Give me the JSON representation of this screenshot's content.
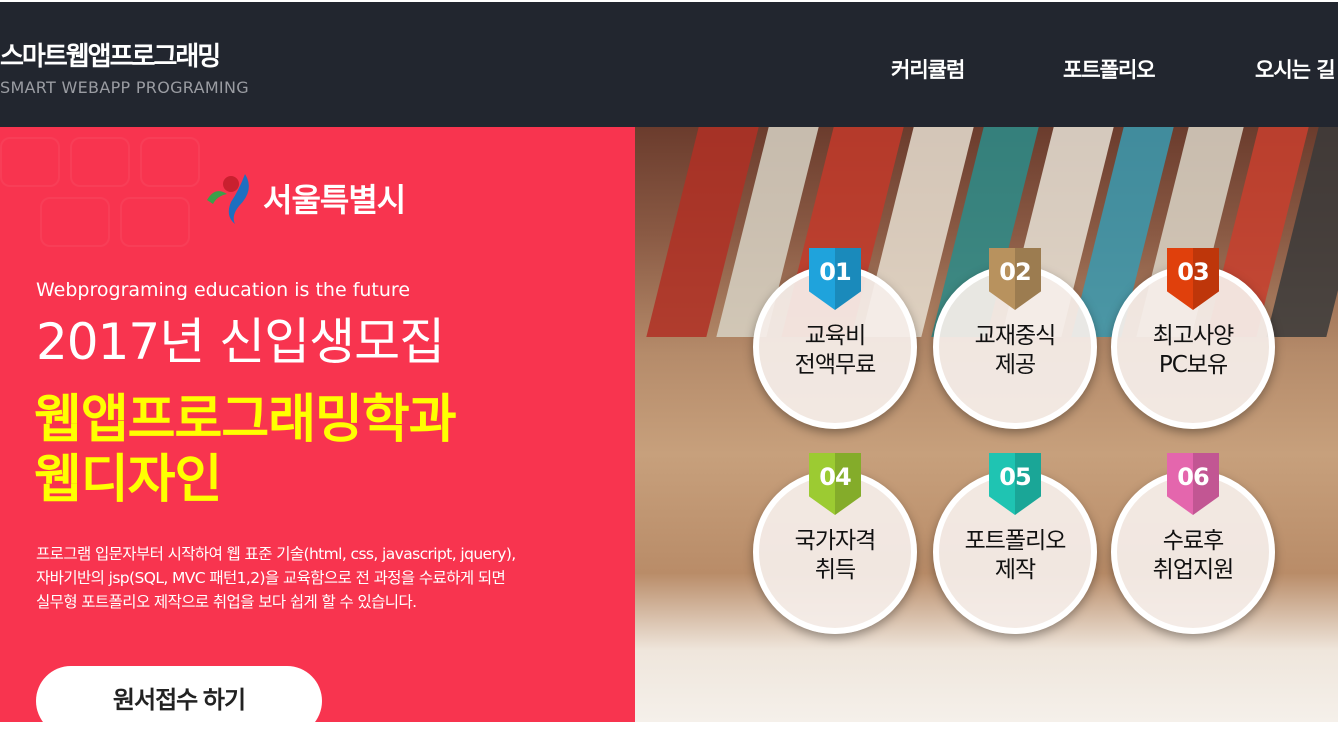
{
  "header": {
    "logo_title": "스마트웹앱프로그래밍",
    "logo_subtitle": "SMART WEBAPP PROGRAMING",
    "nav": [
      {
        "label": "커리큘럼"
      },
      {
        "label": "포트폴리오"
      },
      {
        "label": "오시는 길"
      }
    ]
  },
  "hero": {
    "seoul_logo": "서울특별시",
    "tagline": "Webprograming education is the future",
    "title": "2017년 신입생모집",
    "dept1": "웹앱프로그래밍학과",
    "dept2": "웹디자인",
    "desc": [
      "프로그램 입문자부터 시작하여 웹 표준 기술(html, css, javascript, jquery),",
      "자바기반의 jsp(SQL, MVC 패턴1,2)을 교육함으로 전 과정을 수료하게 되면",
      "실무형 포트폴리오 제작으로 취업을 보다 쉽게 할 수 있습니다."
    ],
    "apply_button": "원서접수 하기"
  },
  "features": [
    {
      "num": "01",
      "line1": "교육비",
      "line2": "전액무료",
      "color": "#1fa3dc"
    },
    {
      "num": "02",
      "line1": "교재중식",
      "line2": "제공",
      "color": "#b8925e"
    },
    {
      "num": "03",
      "line1": "최고사양",
      "line2": "PC보유",
      "color": "#e0400c"
    },
    {
      "num": "04",
      "line1": "국가자격",
      "line2": "취득",
      "color": "#9ccb32"
    },
    {
      "num": "05",
      "line1": "포트폴리오",
      "line2": "제작",
      "color": "#1fc4b2"
    },
    {
      "num": "06",
      "line1": "수료후",
      "line2": "취업지원",
      "color": "#e466ad"
    }
  ]
}
